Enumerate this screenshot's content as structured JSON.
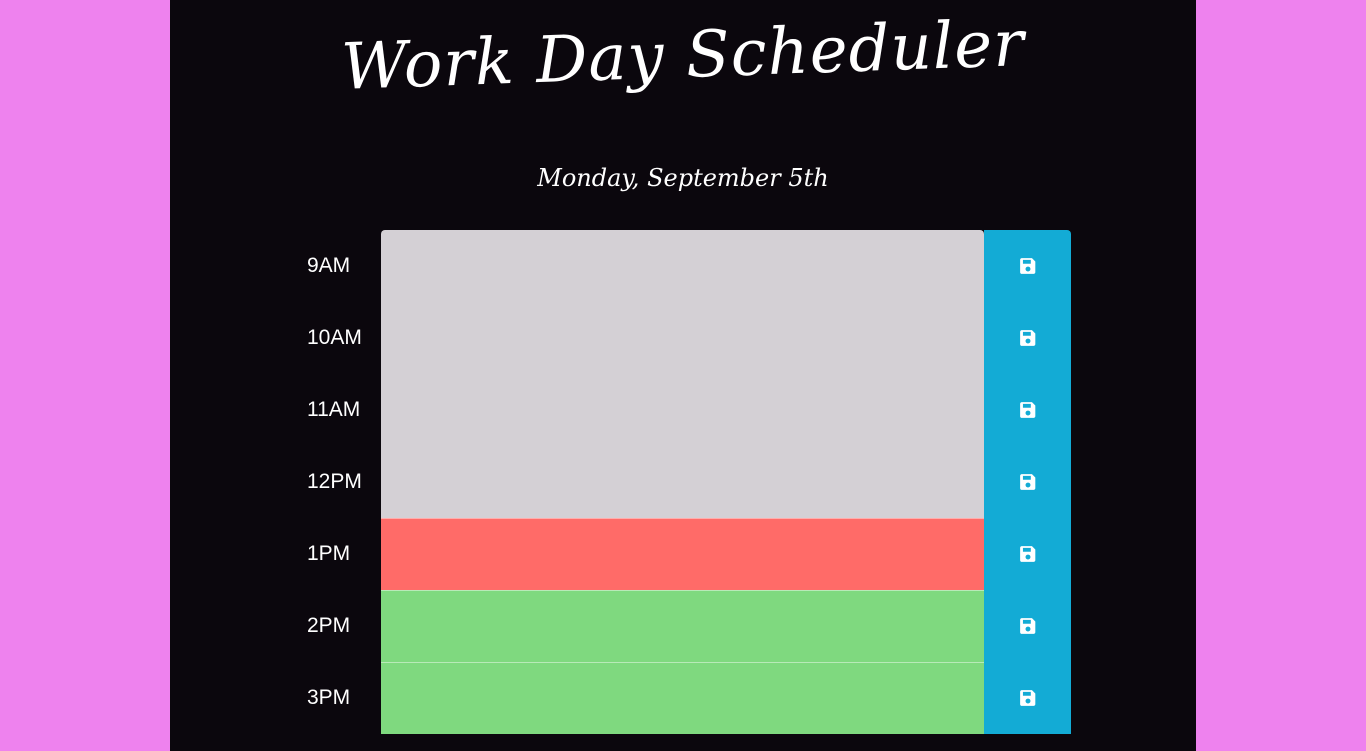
{
  "header": {
    "title": "Work Day Scheduler",
    "date": "Monday, September 5th"
  },
  "rows": [
    {
      "hour": "9AM",
      "status": "past",
      "text": ""
    },
    {
      "hour": "10AM",
      "status": "past",
      "text": ""
    },
    {
      "hour": "11AM",
      "status": "past",
      "text": ""
    },
    {
      "hour": "12PM",
      "status": "past",
      "text": ""
    },
    {
      "hour": "1PM",
      "status": "present",
      "text": ""
    },
    {
      "hour": "2PM",
      "status": "future",
      "text": ""
    },
    {
      "hour": "3PM",
      "status": "future",
      "text": ""
    }
  ],
  "colors": {
    "page_background": "#ee82ee",
    "container_background": "#0b070d",
    "past": "#d4d0d5",
    "present": "#ff6b68",
    "future": "#7fd97f",
    "save_button": "#13abd5"
  },
  "icons": {
    "save": "floppy-disk-icon"
  }
}
